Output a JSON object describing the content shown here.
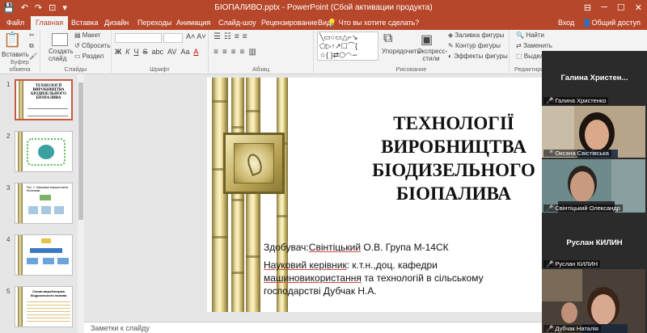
{
  "window": {
    "title": "БІОПАЛИВО.pptx - PowerPoint (Сбой активации продукта)",
    "quick_access": [
      "💾",
      "↶",
      "↷",
      "⊡",
      "▾"
    ],
    "controls": [
      "⊟",
      "─",
      "☐",
      "✕"
    ]
  },
  "tabs": [
    "Файл",
    "Главная",
    "Вставка",
    "Дизайн",
    "Переходы",
    "Анимация",
    "Слайд-шоу",
    "Рецензирование",
    "Вид"
  ],
  "tab_active": "Главная",
  "tell_me": "Что вы хотите сделать?",
  "tabs_right": [
    "Вход",
    "Общий доступ"
  ],
  "ribbon": {
    "clipboard": {
      "paste": "Вставить",
      "label": "Буфер обмена"
    },
    "slides": {
      "create": "Создать слайд",
      "layout": "Макет",
      "reset": "Сбросить",
      "section": "Раздел",
      "label": "Слайды"
    },
    "font": {
      "label": "Шрифт",
      "format_buttons": [
        "Ж",
        "К",
        "Ч",
        "S",
        "abc",
        "AV",
        "Aa",
        "A"
      ]
    },
    "paragraph": {
      "label": "Абзац"
    },
    "drawing": {
      "arrange": "Упорядочить",
      "quick_styles": "Экспресс-стили",
      "fill": "Заливка фигуры",
      "outline": "Контур фигуры",
      "effects": "Эффекты фигуры",
      "label": "Рисование"
    },
    "editing": {
      "find": "Найти",
      "replace": "Заменить",
      "select": "Выделить",
      "label": "Редактирование"
    }
  },
  "thumbnails": [
    {
      "num": "1",
      "selected": true,
      "title": "ТЕХНОЛОГІЇ ВИРОБНИЦТВА БІОДИЗЕЛЬНОГО БІОПАЛИВА"
    },
    {
      "num": "2",
      "selected": false,
      "title": ""
    },
    {
      "num": "3",
      "selected": false,
      "title": "Рис. 1. Напрямки використання біопалива"
    },
    {
      "num": "4",
      "selected": false,
      "title": ""
    },
    {
      "num": "5",
      "selected": false,
      "title": "Схема виробництва біодизельного палива"
    }
  ],
  "slide": {
    "title_lines": [
      "ТЕХНОЛОГІЇ",
      "ВИРОБНИЦТВА",
      "БІОДИЗЕЛЬНОГО",
      "БІОПАЛИВА"
    ],
    "author_prefix": "Здобувач:",
    "author_name": "Свінтіцький",
    "author_rest": " О.В. Група М-14СК",
    "supervisor_label": "Науковий керівник",
    "supervisor_rest": ": к.т.н.,доц. кафедри",
    "supervisor_dept": "машиновикористання",
    "supervisor_rest2": " та технологій в сільському",
    "supervisor_rest3": "господарстві Дубчак Н.А."
  },
  "notes_placeholder": "Заметки к слайду",
  "participants": [
    {
      "kind": "name",
      "big": "Галина  Христен...",
      "caption": "Галина Христенко"
    },
    {
      "kind": "video",
      "caption": "Оксана Свістівська",
      "bg": "#b7a58a",
      "face": "#d9a98a",
      "hair": "#1d1410"
    },
    {
      "kind": "video",
      "caption": "Свінтіцький Олександр",
      "bg": "#6f8a8a",
      "face": "#c89a80",
      "hair": "#2a2420"
    },
    {
      "kind": "name",
      "big": "Руслан КИЛИН",
      "caption": "Руслан КИЛИН"
    },
    {
      "kind": "video",
      "caption": "Дубчак Наталія",
      "bg": "#4a4038",
      "face": "#d8a890",
      "hair": "#3a2418"
    }
  ]
}
